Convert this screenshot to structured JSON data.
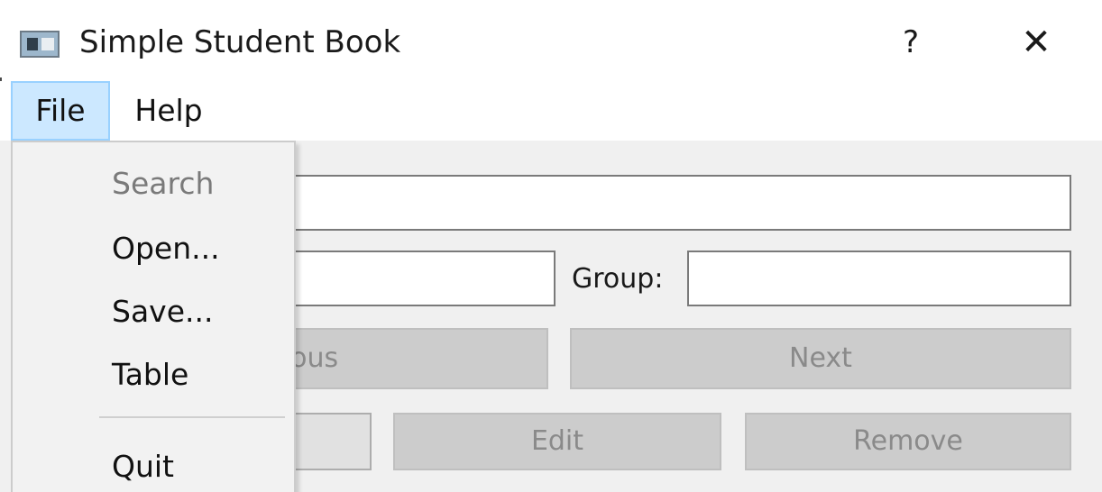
{
  "window": {
    "title": "Simple Student Book",
    "help_button": "?",
    "close_button": "✕",
    "icon": "app-window-icon"
  },
  "menubar": {
    "items": [
      {
        "label": "File",
        "active": true
      },
      {
        "label": "Help",
        "active": false
      }
    ]
  },
  "file_menu": {
    "items": [
      {
        "label": "Search",
        "enabled": false
      },
      {
        "label": "Open...",
        "enabled": true
      },
      {
        "label": "Save...",
        "enabled": true
      },
      {
        "label": "Table",
        "enabled": true
      },
      {
        "separator": true
      },
      {
        "label": "Quit",
        "enabled": true
      }
    ]
  },
  "form": {
    "name_value": "",
    "address_value": "",
    "group_label": "Group:",
    "group_value": "",
    "buttons": {
      "previous": "vious",
      "next": "Next",
      "add": "",
      "edit": "Edit",
      "remove": "Remove"
    }
  },
  "colors": {
    "menu_highlight": "#cce8ff",
    "menu_highlight_border": "#99d1ff",
    "disabled_button": "#cccccc",
    "disabled_text": "#8a8a8a"
  }
}
